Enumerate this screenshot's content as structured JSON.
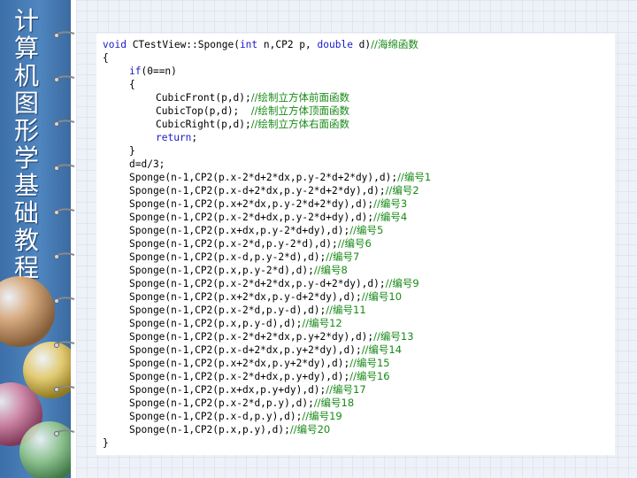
{
  "sidebar": {
    "title_chars": [
      "计",
      "算",
      "机",
      "图",
      "形",
      "学",
      "基",
      "础",
      "教",
      "程"
    ]
  },
  "code": {
    "lines": [
      {
        "indent": 0,
        "segments": [
          {
            "t": "void",
            "k": "kw"
          },
          {
            "t": " CTestView::Sponge("
          },
          {
            "t": "int",
            "k": "kw"
          },
          {
            "t": " n,CP2 p, "
          },
          {
            "t": "double",
            "k": "kw"
          },
          {
            "t": " d)"
          },
          {
            "t": "//海绵函数",
            "k": "cm"
          }
        ]
      },
      {
        "indent": 0,
        "segments": [
          {
            "t": "{"
          }
        ]
      },
      {
        "indent": 1,
        "segments": [
          {
            "t": "if",
            "k": "kw"
          },
          {
            "t": "(0==n)"
          }
        ]
      },
      {
        "indent": 1,
        "segments": [
          {
            "t": "{"
          }
        ]
      },
      {
        "indent": 2,
        "segments": [
          {
            "t": "CubicFront(p,d);"
          },
          {
            "t": "//绘制立方体前面函数",
            "k": "cm"
          }
        ]
      },
      {
        "indent": 2,
        "segments": [
          {
            "t": "CubicTop(p,d);  "
          },
          {
            "t": "//绘制立方体顶面函数",
            "k": "cm"
          }
        ]
      },
      {
        "indent": 2,
        "segments": [
          {
            "t": "CubicRight(p,d);"
          },
          {
            "t": "//绘制立方体右面函数",
            "k": "cm"
          }
        ]
      },
      {
        "indent": 2,
        "segments": [
          {
            "t": "return",
            "k": "kw"
          },
          {
            "t": ";"
          }
        ]
      },
      {
        "indent": 1,
        "segments": [
          {
            "t": "}"
          }
        ]
      },
      {
        "indent": 1,
        "segments": [
          {
            "t": "d=d/3;"
          }
        ]
      },
      {
        "indent": 1,
        "segments": [
          {
            "t": "Sponge(n-1,CP2(p.x-2*d+2*dx,p.y-2*d+2*dy),d);"
          },
          {
            "t": "//编号1",
            "k": "cm"
          }
        ]
      },
      {
        "indent": 1,
        "segments": [
          {
            "t": "Sponge(n-1,CP2(p.x-d+2*dx,p.y-2*d+2*dy),d);"
          },
          {
            "t": "//编号2",
            "k": "cm"
          }
        ]
      },
      {
        "indent": 1,
        "segments": [
          {
            "t": "Sponge(n-1,CP2(p.x+2*dx,p.y-2*d+2*dy),d);"
          },
          {
            "t": "//编号3",
            "k": "cm"
          }
        ]
      },
      {
        "indent": 1,
        "segments": [
          {
            "t": "Sponge(n-1,CP2(p.x-2*d+dx,p.y-2*d+dy),d);"
          },
          {
            "t": "//编号4",
            "k": "cm"
          }
        ]
      },
      {
        "indent": 1,
        "segments": [
          {
            "t": "Sponge(n-1,CP2(p.x+dx,p.y-2*d+dy),d);"
          },
          {
            "t": "//编号5",
            "k": "cm"
          }
        ]
      },
      {
        "indent": 1,
        "segments": [
          {
            "t": "Sponge(n-1,CP2(p.x-2*d,p.y-2*d),d);"
          },
          {
            "t": "//编号6",
            "k": "cm"
          }
        ]
      },
      {
        "indent": 1,
        "segments": [
          {
            "t": "Sponge(n-1,CP2(p.x-d,p.y-2*d),d);"
          },
          {
            "t": "//编号7",
            "k": "cm"
          }
        ]
      },
      {
        "indent": 1,
        "segments": [
          {
            "t": "Sponge(n-1,CP2(p.x,p.y-2*d),d);"
          },
          {
            "t": "//编号8",
            "k": "cm"
          }
        ]
      },
      {
        "indent": 1,
        "segments": [
          {
            "t": "Sponge(n-1,CP2(p.x-2*d+2*dx,p.y-d+2*dy),d);"
          },
          {
            "t": "//编号9",
            "k": "cm"
          }
        ]
      },
      {
        "indent": 1,
        "segments": [
          {
            "t": "Sponge(n-1,CP2(p.x+2*dx,p.y-d+2*dy),d);"
          },
          {
            "t": "//编号10",
            "k": "cm"
          }
        ]
      },
      {
        "indent": 1,
        "segments": [
          {
            "t": "Sponge(n-1,CP2(p.x-2*d,p.y-d),d);"
          },
          {
            "t": "//编号11",
            "k": "cm"
          }
        ]
      },
      {
        "indent": 1,
        "segments": [
          {
            "t": "Sponge(n-1,CP2(p.x,p.y-d),d);"
          },
          {
            "t": "//编号12",
            "k": "cm"
          }
        ]
      },
      {
        "indent": 1,
        "segments": [
          {
            "t": "Sponge(n-1,CP2(p.x-2*d+2*dx,p.y+2*dy),d);"
          },
          {
            "t": "//编号13",
            "k": "cm"
          }
        ]
      },
      {
        "indent": 1,
        "segments": [
          {
            "t": "Sponge(n-1,CP2(p.x-d+2*dx,p.y+2*dy),d);"
          },
          {
            "t": "//编号14",
            "k": "cm"
          }
        ]
      },
      {
        "indent": 1,
        "segments": [
          {
            "t": "Sponge(n-1,CP2(p.x+2*dx,p.y+2*dy),d);"
          },
          {
            "t": "//编号15",
            "k": "cm"
          }
        ]
      },
      {
        "indent": 1,
        "segments": [
          {
            "t": "Sponge(n-1,CP2(p.x-2*d+dx,p.y+dy),d);"
          },
          {
            "t": "//编号16",
            "k": "cm"
          }
        ]
      },
      {
        "indent": 1,
        "segments": [
          {
            "t": "Sponge(n-1,CP2(p.x+dx,p.y+dy),d);"
          },
          {
            "t": "//编号17",
            "k": "cm"
          }
        ]
      },
      {
        "indent": 1,
        "segments": [
          {
            "t": "Sponge(n-1,CP2(p.x-2*d,p.y),d);"
          },
          {
            "t": "//编号18",
            "k": "cm"
          }
        ]
      },
      {
        "indent": 1,
        "segments": [
          {
            "t": "Sponge(n-1,CP2(p.x-d,p.y),d);"
          },
          {
            "t": "//编号19",
            "k": "cm"
          }
        ]
      },
      {
        "indent": 1,
        "segments": [
          {
            "t": "Sponge(n-1,CP2(p.x,p.y),d);"
          },
          {
            "t": "//编号20",
            "k": "cm"
          }
        ]
      },
      {
        "indent": 0,
        "segments": [
          {
            "t": "}"
          }
        ]
      }
    ]
  },
  "colors": {
    "keyword": "#1a1acc",
    "comment": "#178a17",
    "sidebar_blue": "#4f86c0"
  }
}
